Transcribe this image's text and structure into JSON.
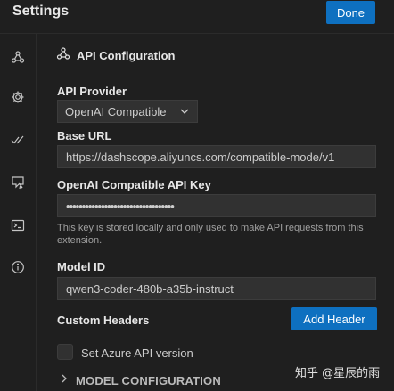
{
  "header": {
    "title": "Settings",
    "done_label": "Done"
  },
  "sidebar": {
    "items": [
      {
        "icon": "webhook-icon"
      },
      {
        "icon": "gear-icon"
      },
      {
        "icon": "check-all-icon"
      },
      {
        "icon": "comment-pointer-icon"
      },
      {
        "icon": "terminal-icon"
      },
      {
        "icon": "info-icon"
      }
    ]
  },
  "section": {
    "title": "API Configuration",
    "api_provider_label": "API Provider",
    "api_provider_value": "OpenAI Compatible",
    "base_url_label": "Base URL",
    "base_url_value": "https://dashscope.aliyuncs.com/compatible-mode/v1",
    "api_key_label": "OpenAI Compatible API Key",
    "api_key_value": "••••••••••••••••••••••••••••••••••",
    "api_key_hint": "This key is stored locally and only used to make API requests from this extension.",
    "model_id_label": "Model ID",
    "model_id_value": "qwen3-coder-480b-a35b-instruct",
    "custom_headers_label": "Custom Headers",
    "add_header_label": "Add Header",
    "azure_checkbox_label": "Set Azure API version",
    "model_config_label": "MODEL CONFIGURATION"
  },
  "watermark": "知乎 @星辰的雨"
}
